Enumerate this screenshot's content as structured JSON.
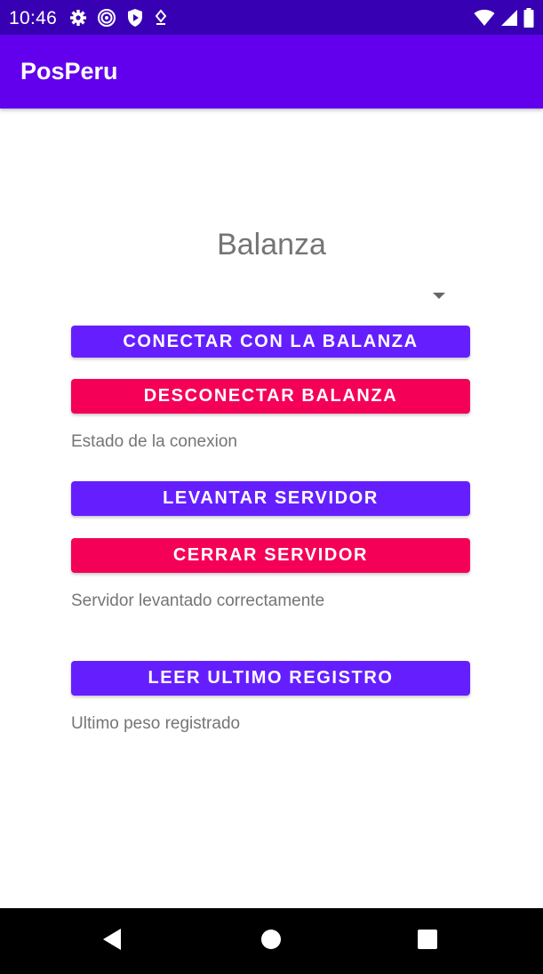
{
  "status_bar": {
    "time": "10:46",
    "left_icons": [
      "gear-icon",
      "target-icon",
      "shield-play-icon",
      "location-pin-icon"
    ],
    "right_icons": [
      "wifi-icon",
      "signal-icon",
      "battery-icon"
    ]
  },
  "app_bar": {
    "title": "PosPeru",
    "color": "#6200ee"
  },
  "main": {
    "heading": "Balanza",
    "spinner": {
      "selected": ""
    },
    "connect_button": "CONECTAR CON LA BALANZA",
    "disconnect_button": "DESCONECTAR BALANZA",
    "connection_status": "Estado de la conexion",
    "start_server_button": "LEVANTAR SERVIDOR",
    "stop_server_button": "CERRAR SERVIDOR",
    "server_status": "Servidor levantado correctamente",
    "read_last_button": "LEER ULTIMO REGISTRO",
    "last_weight": "Ultimo peso registrado"
  },
  "colors": {
    "status_bar": "#3700b3",
    "primary_button": "#651fff",
    "accent_button": "#f50057",
    "secondary_text": "#757575"
  },
  "nav_bar": {
    "buttons": [
      "back-icon",
      "home-icon",
      "recents-icon"
    ]
  }
}
